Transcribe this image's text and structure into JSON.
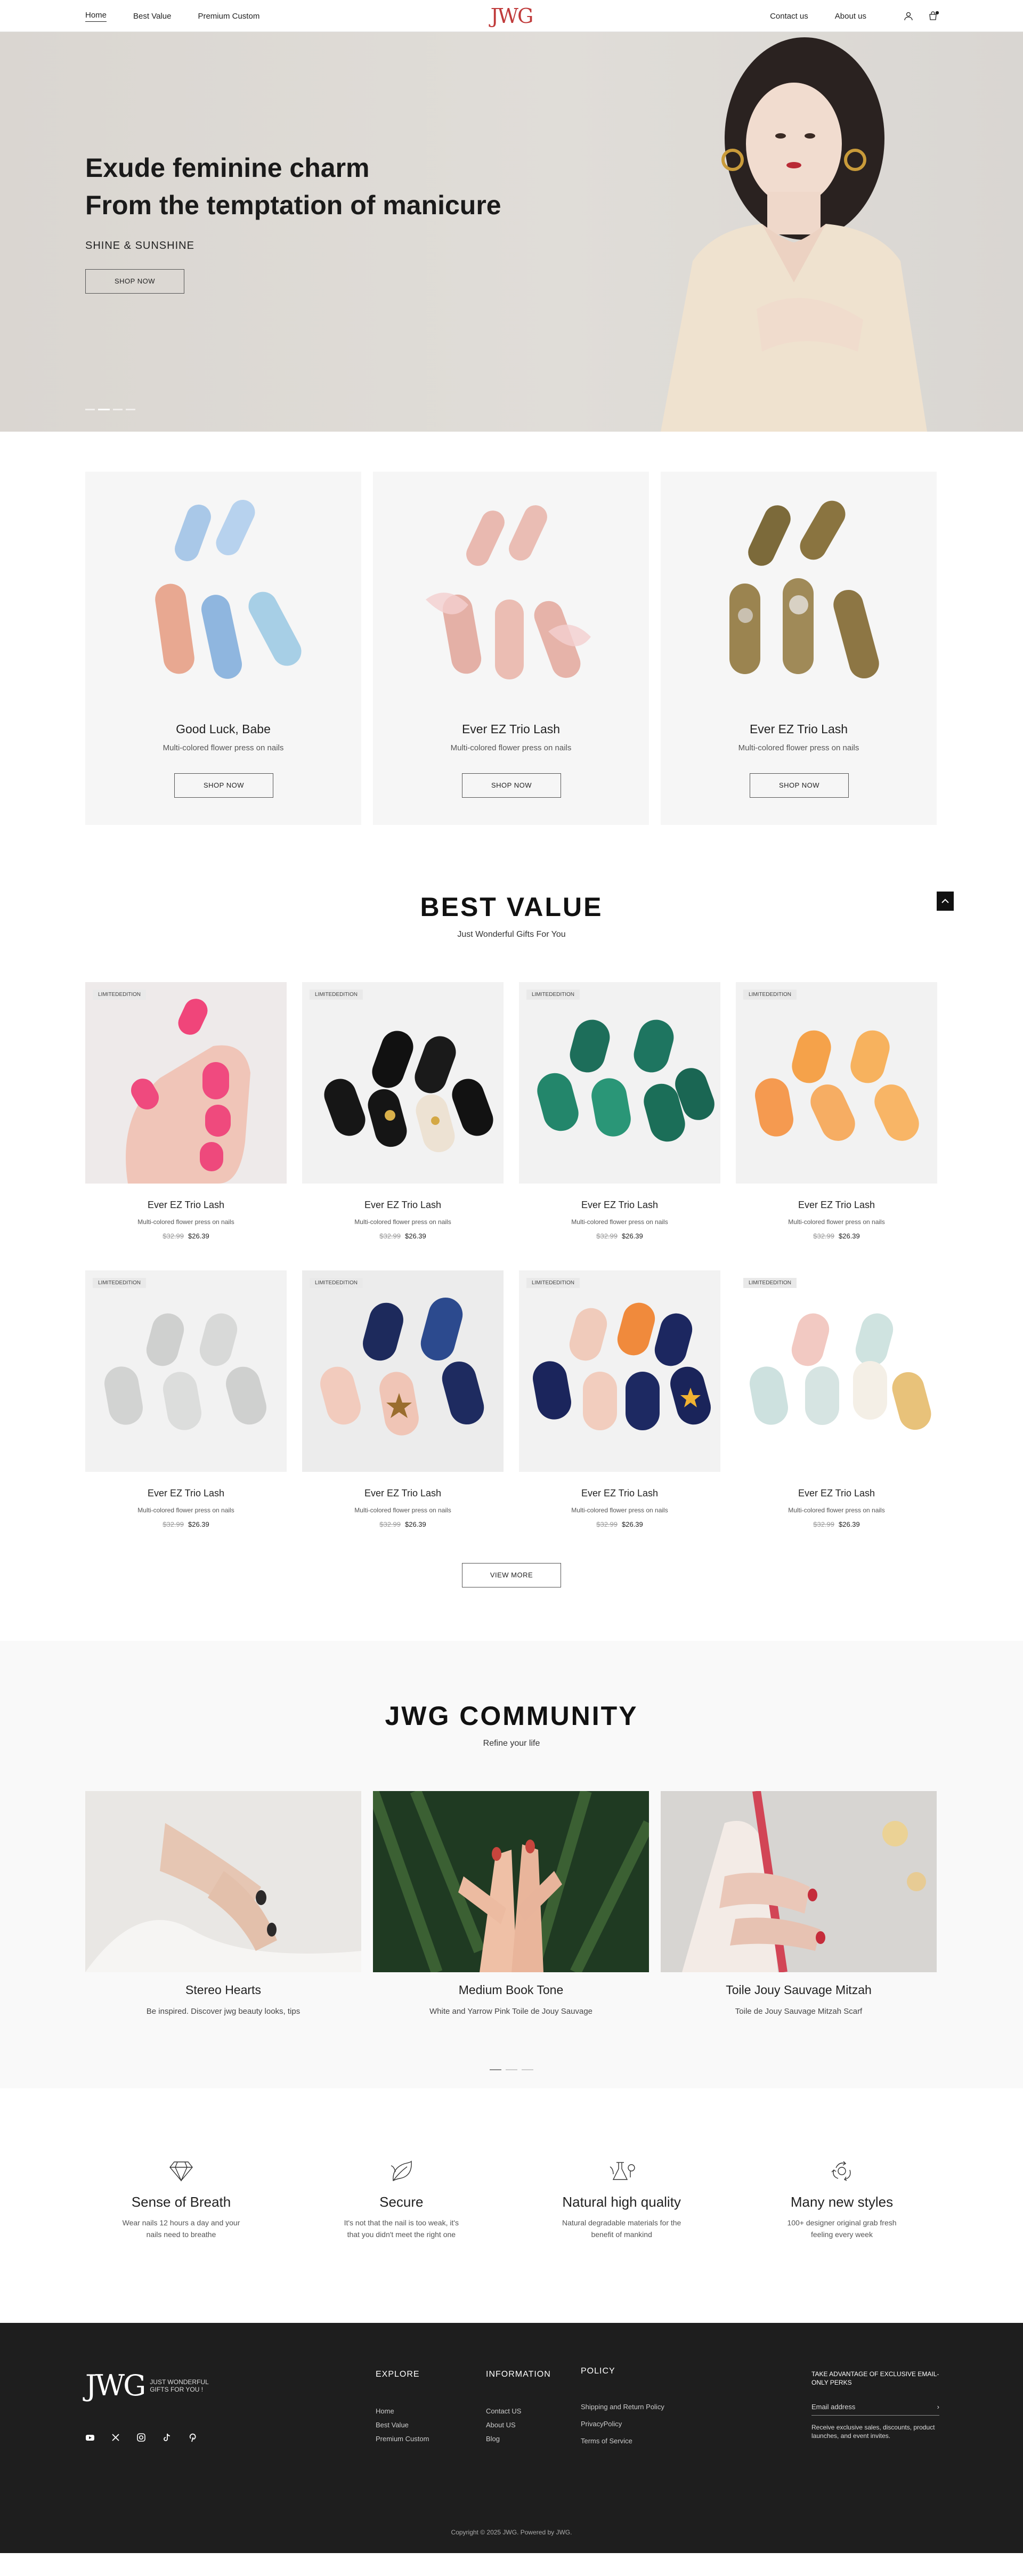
{
  "nav": {
    "items": [
      "Home",
      "Best Value",
      "Premium Custom"
    ],
    "right": [
      "Contact us",
      "About us"
    ],
    "logo": "JWG"
  },
  "hero": {
    "line1": "Exude feminine charm",
    "line2": "From the temptation of manicure",
    "sub": "SHINE & SUNSHINE",
    "cta": "SHOP NOW"
  },
  "features": [
    {
      "title": "Good Luck, Babe",
      "desc": "Multi-colored flower press on nails",
      "cta": "SHOP NOW"
    },
    {
      "title": "Ever EZ Trio Lash",
      "desc": "Multi-colored flower press on nails",
      "cta": "SHOP NOW"
    },
    {
      "title": "Ever EZ Trio Lash",
      "desc": "Multi-colored flower press on nails",
      "cta": "SHOP NOW"
    }
  ],
  "best": {
    "title": "BEST  VALUE",
    "sub": "Just Wonderful Gifts For You",
    "view_more": "VIEW MORE",
    "products": [
      {
        "badge": "LIMITEDEDITION",
        "name": "Ever EZ Trio Lash",
        "desc": "Multi-colored flower press on nails",
        "old": "$32.99",
        "price": "$26.39"
      },
      {
        "badge": "LIMITEDEDITION",
        "name": "Ever EZ Trio Lash",
        "desc": "Multi-colored flower press on nails",
        "old": "$32.99",
        "price": "$26.39"
      },
      {
        "badge": "LIMITEDEDITION",
        "name": "Ever EZ Trio Lash",
        "desc": "Multi-colored flower press on nails",
        "old": "$32.99",
        "price": "$26.39"
      },
      {
        "badge": "LIMITEDEDITION",
        "name": "Ever EZ Trio Lash",
        "desc": "Multi-colored flower press on nails",
        "old": "$32.99",
        "price": "$26.39"
      },
      {
        "badge": "LIMITEDEDITION",
        "name": "Ever EZ Trio Lash",
        "desc": "Multi-colored flower press on nails",
        "old": "$32.99",
        "price": "$26.39"
      },
      {
        "badge": "LIMITEDEDITION",
        "name": "Ever EZ Trio Lash",
        "desc": "Multi-colored flower press on nails",
        "old": "$32.99",
        "price": "$26.39"
      },
      {
        "badge": "LIMITEDEDITION",
        "name": "Ever EZ Trio Lash",
        "desc": "Multi-colored flower press on nails",
        "old": "$32.99",
        "price": "$26.39"
      },
      {
        "badge": "LIMITEDEDITION",
        "name": "Ever EZ Trio Lash",
        "desc": "Multi-colored flower press on nails",
        "old": "$32.99",
        "price": "$26.39"
      }
    ]
  },
  "community": {
    "title": "JWG  COMMUNITY",
    "sub": "Refine your life",
    "posts": [
      {
        "title": "Stereo Hearts",
        "desc": "Be inspired. Discover jwg beauty looks, tips"
      },
      {
        "title": "Medium Book Tone",
        "desc": "White and Yarrow Pink Toile de Jouy Sauvage"
      },
      {
        "title": "Toile Jouy Sauvage Mitzah",
        "desc": "Toile de Jouy Sauvage Mitzah Scarf"
      }
    ]
  },
  "perks": [
    {
      "icon": "diamond-icon",
      "title": "Sense of Breath",
      "desc": "Wear nails 12 hours a day and your nails need to breathe"
    },
    {
      "icon": "leaf-icon",
      "title": "Secure",
      "desc": "It's not that the nail is too weak, it's that you didn't meet the right one"
    },
    {
      "icon": "flask-icon",
      "title": "Natural high quality",
      "desc": "Natural degradable materials for the benefit of mankind"
    },
    {
      "icon": "recycle-icon",
      "title": "Many new styles",
      "desc": "100+ designer original grab fresh feeling every week"
    }
  ],
  "footer": {
    "tagline": "JUST WONDERFUL GIFTS FOR YOU !",
    "explore": {
      "title": "EXPLORE",
      "links": [
        "Home",
        "Best Value",
        "Premium Custom"
      ]
    },
    "info": {
      "title": "INFORMATION",
      "links": [
        "Contact US",
        "About US",
        "Blog"
      ]
    },
    "policy": {
      "title": "POLICY",
      "links": [
        "Shipping and Return Policy",
        "PrivacyPolicy",
        "Terms of Service"
      ]
    },
    "news_title": "TAKE ADVANTAGE OF EXCLUSIVE EMAIL-ONLY PERKS",
    "email_placeholder": "Email address",
    "news_desc": "Receive exclusive sales, discounts, product launches, and event invites.",
    "copyright": "Copyright © 2025 JWG. Powered by JWG."
  }
}
